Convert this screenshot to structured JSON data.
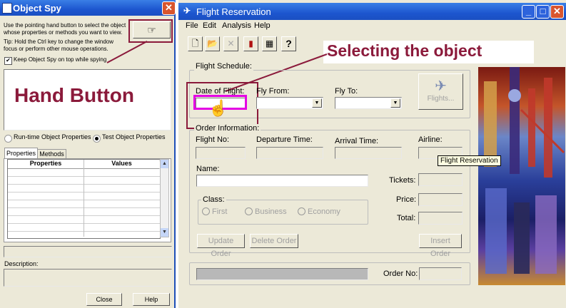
{
  "spy": {
    "title": "Object Spy",
    "instruction": "Use the pointing hand button to select the object whose properties or methods you want to view.",
    "tip": "Tip: Hold the Ctrl key to change the window focus or perform other mouse operations.",
    "keep_on_top": "Keep Object Spy on top while spying",
    "radio_runtime": "Run-time Object Properties",
    "radio_test": "Test Object Properties",
    "tab_properties": "Properties",
    "tab_methods": "Methods",
    "col_properties": "Properties",
    "col_values": "Values",
    "description_label": "Description:",
    "close_label": "Close",
    "help_label": "Help"
  },
  "flight": {
    "title": "Flight Reservation",
    "menu": [
      "File",
      "Edit",
      "Analysis",
      "Help"
    ],
    "schedule_label": "Flight Schedule:",
    "date_label": "Date of Flight:",
    "fly_from_label": "Fly From:",
    "fly_to_label": "Fly To:",
    "flights_button": "Flights...",
    "order_info_label": "Order Information:",
    "flight_no_label": "Flight No:",
    "departure_label": "Departure Time:",
    "arrival_label": "Arrival Time:",
    "airline_label": "Airline:",
    "name_label": "Name:",
    "tickets_label": "Tickets:",
    "class_label": "Class:",
    "class_first": "First",
    "class_business": "Business",
    "class_economy": "Economy",
    "price_label": "Price:",
    "total_label": "Total:",
    "update_order": "Update Order",
    "delete_order": "Delete Order",
    "insert_order": "Insert Order",
    "order_no_label": "Order No:",
    "tooltip": "Flight Reservation"
  },
  "annotations": {
    "hand_button": "Hand Button",
    "selecting": "Selecting the object"
  },
  "colors": {
    "annotation_text": "#8b1a3b",
    "highlight": "#e400e4",
    "title_bar": "#1d56cf"
  }
}
